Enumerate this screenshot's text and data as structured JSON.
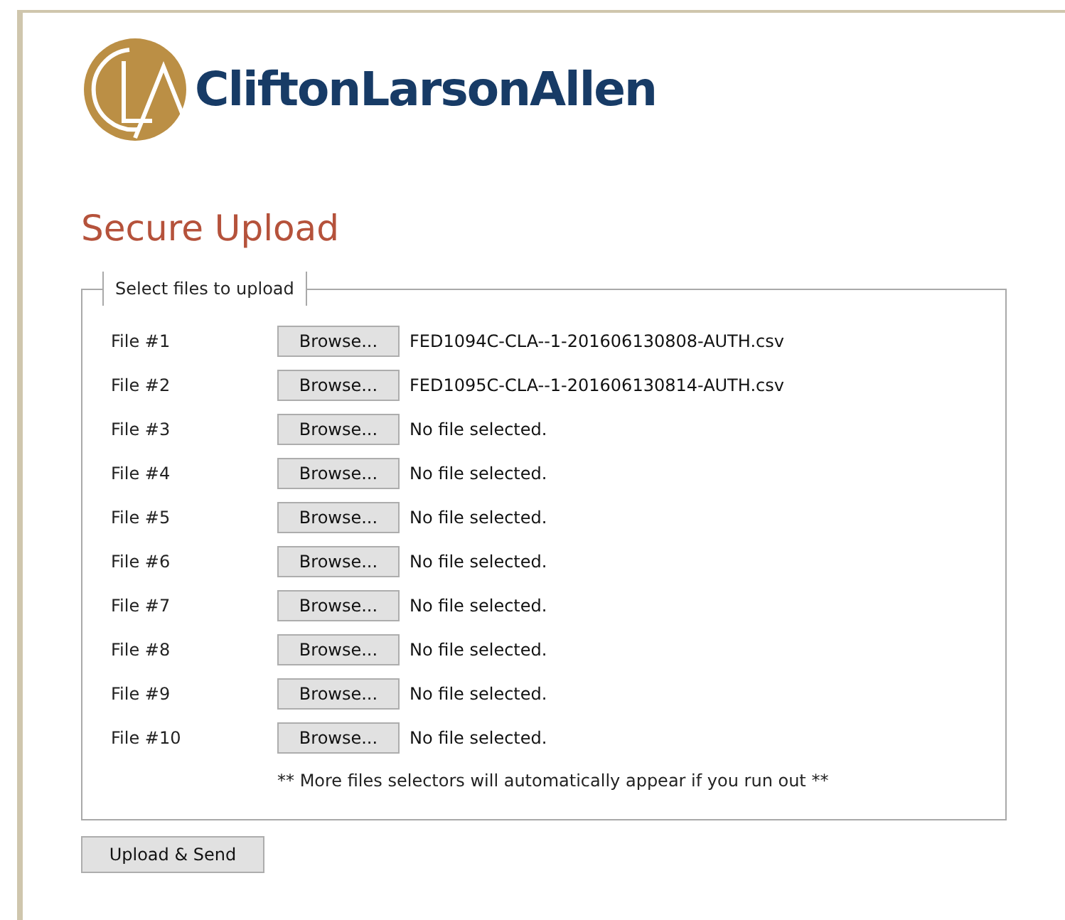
{
  "brand": {
    "name": "CliftonLarsonAllen"
  },
  "title": "Secure Upload",
  "fieldset": {
    "legend": "Select files to upload",
    "files": [
      {
        "label": "File #1",
        "button": "Browse...",
        "status": "FED1094C-CLA--1-201606130808-AUTH.csv"
      },
      {
        "label": "File #2",
        "button": "Browse...",
        "status": "FED1095C-CLA--1-201606130814-AUTH.csv"
      },
      {
        "label": "File #3",
        "button": "Browse...",
        "status": "No file selected."
      },
      {
        "label": "File #4",
        "button": "Browse...",
        "status": "No file selected."
      },
      {
        "label": "File #5",
        "button": "Browse...",
        "status": "No file selected."
      },
      {
        "label": "File #6",
        "button": "Browse...",
        "status": "No file selected."
      },
      {
        "label": "File #7",
        "button": "Browse...",
        "status": "No file selected."
      },
      {
        "label": "File #8",
        "button": "Browse...",
        "status": "No file selected."
      },
      {
        "label": "File #9",
        "button": "Browse...",
        "status": "No file selected."
      },
      {
        "label": "File #10",
        "button": "Browse...",
        "status": "No file selected."
      }
    ],
    "note": "** More files selectors will automatically appear if you run out **"
  },
  "submit": "Upload & Send"
}
